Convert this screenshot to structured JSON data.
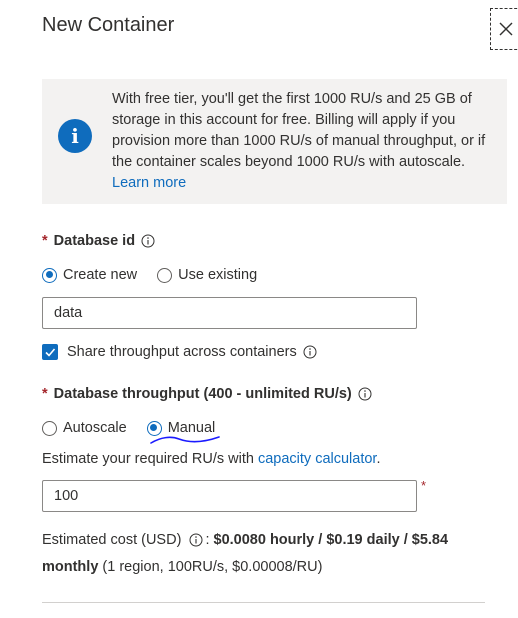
{
  "header": {
    "title": "New Container",
    "close_icon": "close-icon"
  },
  "banner": {
    "icon": "info-icon",
    "icon_glyph": "i",
    "text": "With free tier, you'll get the first 1000 RU/s and 25 GB of storage in this account for free. Billing will apply if you provision more than 1000 RU/s of manual throughput, or if the container scales beyond 1000 RU/s with autoscale.",
    "link": "Learn more"
  },
  "database_id": {
    "required_marker": "*",
    "label": "Database id",
    "options": [
      {
        "label": "Create new",
        "selected": true
      },
      {
        "label": "Use existing",
        "selected": false
      }
    ],
    "value": "data",
    "share_throughput": {
      "label": "Share throughput across containers",
      "checked": true
    }
  },
  "throughput": {
    "required_marker": "*",
    "label": "Database throughput (400 - unlimited RU/s)",
    "options": [
      {
        "label": "Autoscale",
        "selected": false
      },
      {
        "label": "Manual",
        "selected": true
      }
    ],
    "estimate_prefix": "Estimate your required RU/s with",
    "estimate_link": "capacity calculator",
    "estimate_suffix": ".",
    "value": "100",
    "input_required_marker": "*"
  },
  "cost": {
    "label": "Estimated cost (USD)",
    "colon": ":",
    "amount": "$0.0080 hourly / $0.19 daily / $5.84 monthly",
    "details": "(1 region, 100RU/s, $0.00008/RU)"
  },
  "colors": {
    "accent": "#0f6cbd",
    "required": "#a4262c",
    "banner_bg": "#f3f2f1"
  }
}
